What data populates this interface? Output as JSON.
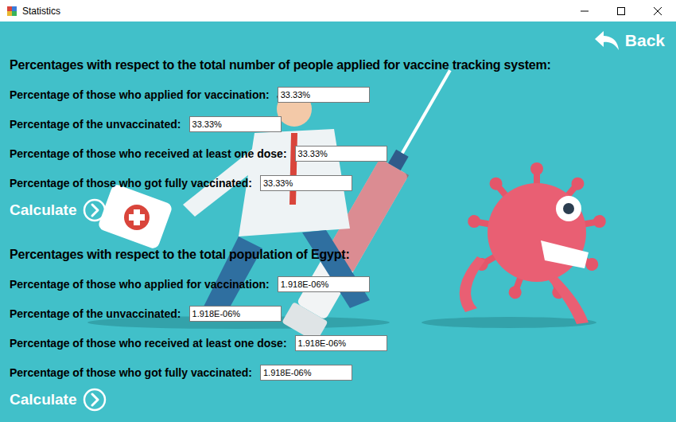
{
  "window": {
    "title": "Statistics"
  },
  "back": {
    "label": "Back"
  },
  "sections": [
    {
      "heading": "Percentages with respect to the total number of people applied for vaccine tracking system:",
      "fields": [
        {
          "label": "Percentage of those who applied for vaccination:",
          "value": "33.33%"
        },
        {
          "label": "Percentage of the unvaccinated:",
          "value": "33.33%"
        },
        {
          "label": "Percentage of those who received at least one dose:",
          "value": "33.33%"
        },
        {
          "label": "Percentage of those who got fully vaccinated:",
          "value": "33.33%"
        }
      ],
      "button": "Calculate"
    },
    {
      "heading": "Percentages with respect to the total population of Egypt:",
      "fields": [
        {
          "label": "Percentage of those who applied for vaccination:",
          "value": "1.918E-06%"
        },
        {
          "label": "Percentage of the unvaccinated:",
          "value": "1.918E-06%"
        },
        {
          "label": "Percentage of those who received at least one dose:",
          "value": "1.918E-06%"
        },
        {
          "label": "Percentage of those who got fully vaccinated:",
          "value": "1.918E-06%"
        }
      ],
      "button": "Calculate"
    }
  ]
}
